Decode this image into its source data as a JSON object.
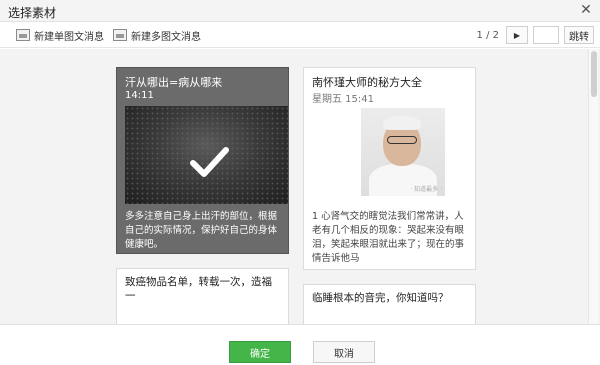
{
  "dialog": {
    "title": "选择素材"
  },
  "toolbar": {
    "new_single_label": "新建单图文消息",
    "new_multi_label": "新建多图文消息",
    "page_indicator": "1 / 2",
    "jump_label": "跳转"
  },
  "cards": [
    {
      "title": "汗从哪出=病从哪来",
      "date": "14:11",
      "desc": "多多注意自己身上出汗的部位，根据自己的实际情况，保护好自己的身体健康吧。",
      "selected": true
    },
    {
      "title": "南怀瑾大师的秘方大全",
      "date": "星期五 15:41",
      "desc": "1 心肾气交的瞎觉法我们常常讲，人老有几个相反的现象：哭起来没有眼泪，笑起来眼泪就出来了；现在的事情告诉他马",
      "selected": false
    },
    {
      "title": "致癌物品名单，转载一次，造福一",
      "selected": false
    },
    {
      "title": "临睡根本的音完，你知道吗？",
      "selected": false
    }
  ],
  "footer": {
    "ok_label": "确定",
    "cancel_label": "取消"
  },
  "colors": {
    "ok_button": "#44b549",
    "selected_card": "#6b6b6b"
  }
}
